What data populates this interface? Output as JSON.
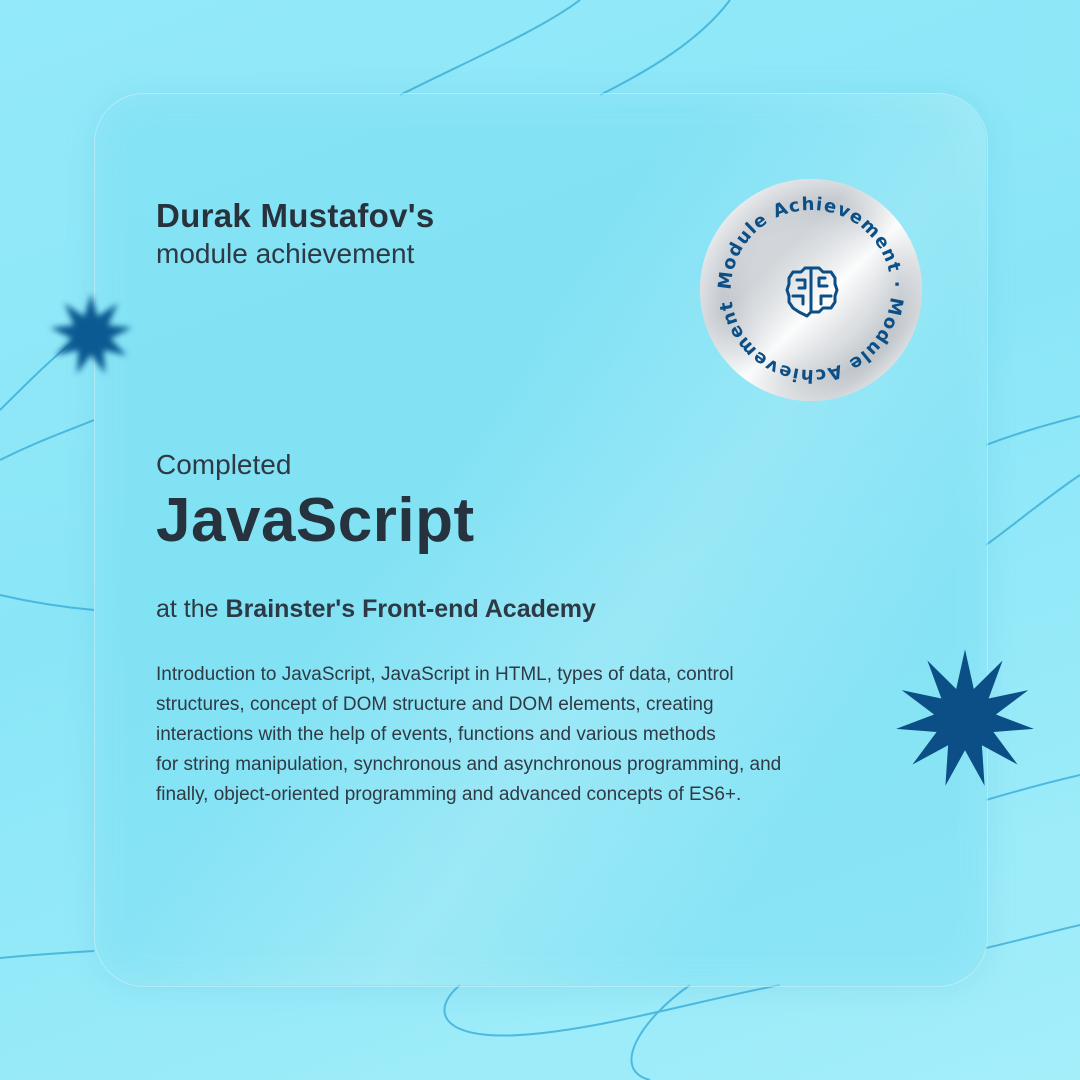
{
  "certificate": {
    "recipient_name": "Durak Mustafov's",
    "subtitle": "module achievement",
    "completed_label": "Completed",
    "course_name": "JavaScript",
    "academy_prefix": "at the",
    "academy_name": "Brainster's Front-end Academy",
    "description_lines": [
      "Introduction to JavaScript, JavaScript in HTML, types of data, control",
      "structures, concept of DOM structure and DOM elements, creating",
      "interactions with the help of events, functions and various methods",
      "for string manipulation, synchronous and asynchronous programming, and",
      "finally, object-oriented programming and advanced concepts of ES6+."
    ]
  },
  "badge": {
    "ring_text": "Module Achievement · Module Achievement ·",
    "icon": "brain-icon"
  },
  "colors": {
    "background": "#8ae6f7",
    "text_dark": "#27323d",
    "accent_navy": "#0b4f86",
    "line_blue": "#3aa9d8"
  }
}
